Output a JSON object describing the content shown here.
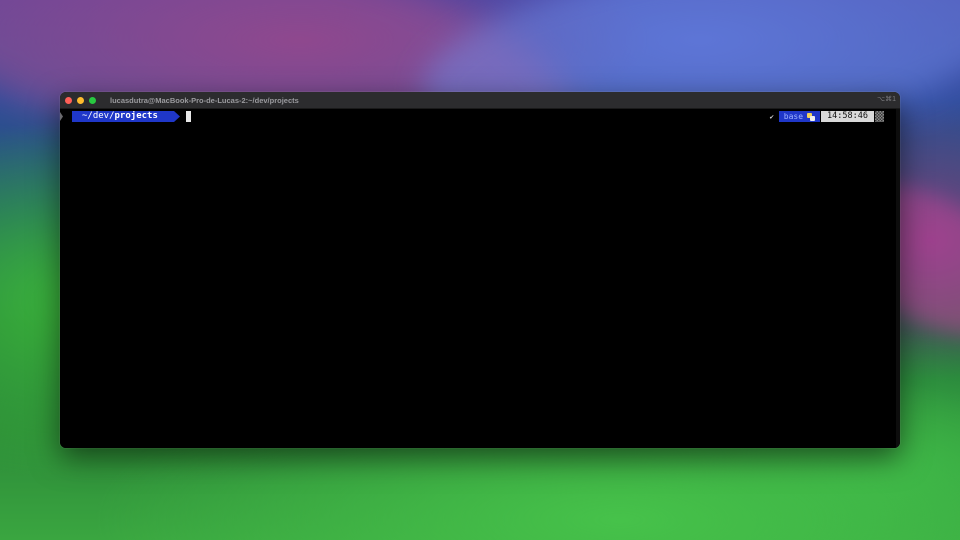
{
  "window": {
    "title": "lucasdutra@MacBook-Pro-de-Lucas-2:~/dev/projects",
    "shortcut": "⌥⌘1"
  },
  "prompt": {
    "path_prefix": "~/dev/",
    "path_current": "projects",
    "status_check": "✔",
    "env_name": "base",
    "time": "14:58:46"
  },
  "colors": {
    "path_segment": "#1f37c8",
    "time_segment": "#d9d9d9",
    "terminal_bg": "#000000",
    "titlebar_bg": "#2c2c2e"
  },
  "icons": {
    "traffic_close": "close-icon",
    "traffic_minimize": "minimize-icon",
    "traffic_maximize": "maximize-icon",
    "env": "python-icon"
  }
}
